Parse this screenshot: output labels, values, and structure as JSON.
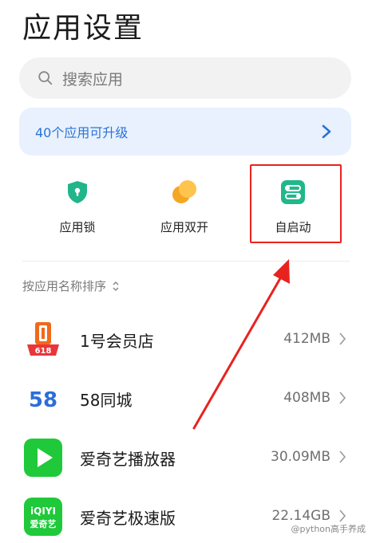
{
  "header": {
    "title": "应用设置"
  },
  "search": {
    "placeholder": "搜索应用"
  },
  "upgrade_banner": {
    "text": "40个应用可升级"
  },
  "quick_actions": [
    {
      "label": "应用锁"
    },
    {
      "label": "应用双开"
    },
    {
      "label": "自启动"
    }
  ],
  "sort": {
    "label": "按应用名称排序"
  },
  "apps": [
    {
      "name": "1号会员店",
      "size": "412MB"
    },
    {
      "name": "58同城",
      "size": "408MB"
    },
    {
      "name": "爱奇艺播放器",
      "size": "30.09MB"
    },
    {
      "name": "爱奇艺极速版",
      "size": "22.14GB"
    }
  ],
  "icon_text": {
    "app1_badge": "618",
    "app2_logo": "58",
    "app4_line1": "iQIYI",
    "app4_line2": "爱奇艺"
  },
  "watermark": "@python高手养成",
  "colors": {
    "accent_blue": "#2a73d9",
    "highlight_red": "#e8231f",
    "lock_green": "#21b58a"
  }
}
